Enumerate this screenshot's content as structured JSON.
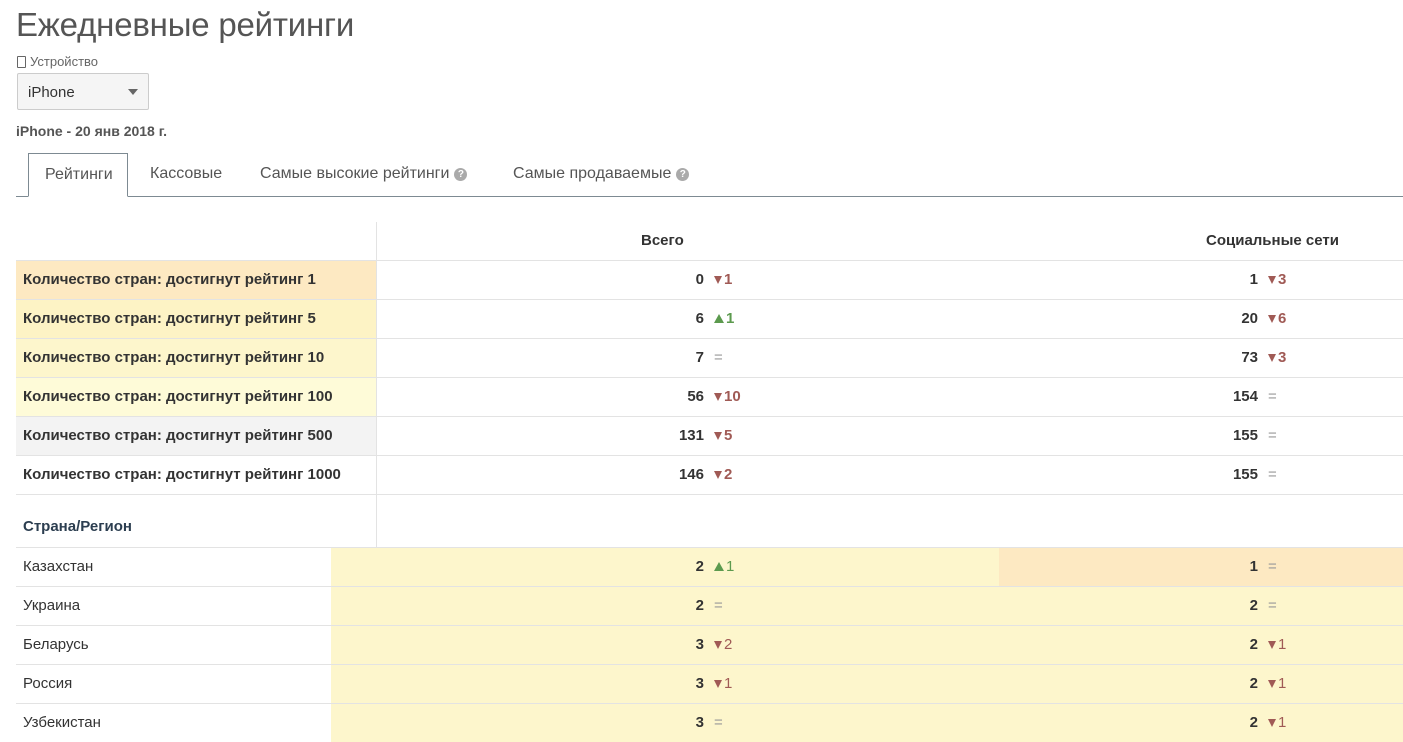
{
  "page": {
    "title": "Ежедневные рейтинги",
    "device_label": "Устройство",
    "device_icon": "phone-icon",
    "device_value": "iPhone",
    "subtitle": "iPhone - 20 янв 2018 г."
  },
  "tabs": [
    {
      "label": "Рейтинги",
      "active": true
    },
    {
      "label": "Кассовые",
      "active": false
    },
    {
      "label": "Самые высокие рейтинги",
      "active": false,
      "help_icon": "question-circle-icon",
      "help_glyph": "?"
    },
    {
      "label": "Самые продаваемые",
      "active": false,
      "help_icon": "question-circle-icon",
      "help_glyph": "?"
    }
  ],
  "columns": {
    "total": "Всего",
    "social": "Социальные сети"
  },
  "summary_rows": [
    {
      "label": "Количество стран: достигнут рейтинг 1",
      "bg": "#fde9c2",
      "total": {
        "value": "0",
        "change": "1",
        "dir": "down"
      },
      "social": {
        "value": "1",
        "change": "3",
        "dir": "down"
      }
    },
    {
      "label": "Количество стран: достигнут рейтинг 5",
      "bg": "#fdf3c5",
      "total": {
        "value": "6",
        "change": "1",
        "dir": "up"
      },
      "social": {
        "value": "20",
        "change": "6",
        "dir": "down"
      }
    },
    {
      "label": "Количество стран: достигнут рейтинг 10",
      "bg": "#fdf6cc",
      "total": {
        "value": "7",
        "change": "=",
        "dir": "eq"
      },
      "social": {
        "value": "73",
        "change": "3",
        "dir": "down"
      }
    },
    {
      "label": "Количество стран: достигнут рейтинг 100",
      "bg": "#fefbd8",
      "total": {
        "value": "56",
        "change": "10",
        "dir": "down"
      },
      "social": {
        "value": "154",
        "change": "=",
        "dir": "eq"
      }
    },
    {
      "label": "Количество стран: достигнут рейтинг 500",
      "bg": "#f3f3f3",
      "total": {
        "value": "131",
        "change": "5",
        "dir": "down"
      },
      "social": {
        "value": "155",
        "change": "=",
        "dir": "eq"
      }
    },
    {
      "label": "Количество стран: достигнут рейтинг 1000",
      "bg": "#ffffff",
      "total": {
        "value": "146",
        "change": "2",
        "dir": "down"
      },
      "social": {
        "value": "155",
        "change": "=",
        "dir": "eq"
      }
    }
  ],
  "region_header": "Страна/Регион",
  "country_rows": [
    {
      "name": "Казахстан",
      "total_bg": "#fdf6cc",
      "social_bg": "#fde9c2",
      "total": {
        "value": "2",
        "change": "1",
        "dir": "up"
      },
      "social": {
        "value": "1",
        "change": "=",
        "dir": "eq"
      }
    },
    {
      "name": "Украина",
      "total_bg": "#fdf6cc",
      "social_bg": "#fdf6cc",
      "total": {
        "value": "2",
        "change": "=",
        "dir": "eq"
      },
      "social": {
        "value": "2",
        "change": "=",
        "dir": "eq"
      }
    },
    {
      "name": "Беларусь",
      "total_bg": "#fdf6cc",
      "social_bg": "#fdf6cc",
      "total": {
        "value": "3",
        "change": "2",
        "dir": "down"
      },
      "social": {
        "value": "2",
        "change": "1",
        "dir": "down"
      }
    },
    {
      "name": "Россия",
      "total_bg": "#fdf6cc",
      "social_bg": "#fdf6cc",
      "total": {
        "value": "3",
        "change": "1",
        "dir": "down"
      },
      "social": {
        "value": "2",
        "change": "1",
        "dir": "down"
      }
    },
    {
      "name": "Узбекистан",
      "total_bg": "#fdf6cc",
      "social_bg": "#fdf6cc",
      "total": {
        "value": "3",
        "change": "=",
        "dir": "eq"
      },
      "social": {
        "value": "2",
        "change": "1",
        "dir": "down"
      }
    }
  ]
}
